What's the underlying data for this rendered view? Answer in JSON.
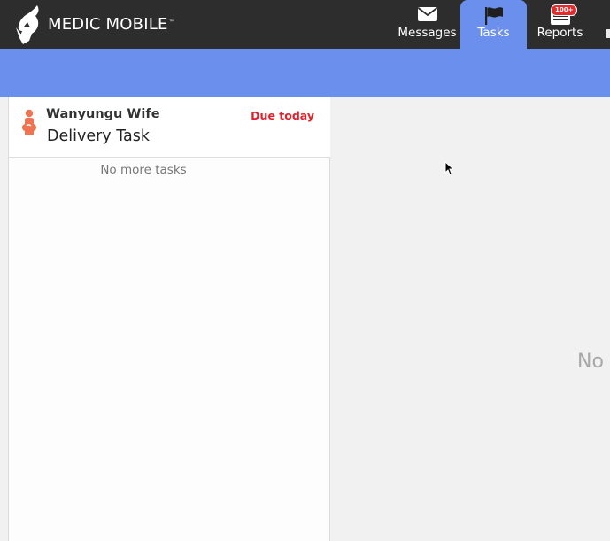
{
  "header": {
    "brand_text": "MEDIC MOBILE",
    "brand_tm": "™",
    "tabs": [
      {
        "label": "Messages",
        "icon": "envelope-icon",
        "active": false
      },
      {
        "label": "Tasks",
        "icon": "flag-icon",
        "active": true
      },
      {
        "label": "Reports",
        "icon": "reports-icon",
        "active": false,
        "badge": "100+"
      }
    ]
  },
  "tasks": {
    "items": [
      {
        "contact_name": "Wanyungu Wife",
        "due_label": "Due today",
        "title": "Delivery Task",
        "icon": "pregnant-woman-icon"
      }
    ],
    "no_more_label": "No more tasks"
  },
  "detail": {
    "empty_label": "No"
  },
  "colors": {
    "header_bg": "#2d2d2d",
    "accent_blue": "#6b8fec",
    "due_red": "#e0212b",
    "task_icon": "#f07451",
    "badge_red": "#e52c2c"
  }
}
